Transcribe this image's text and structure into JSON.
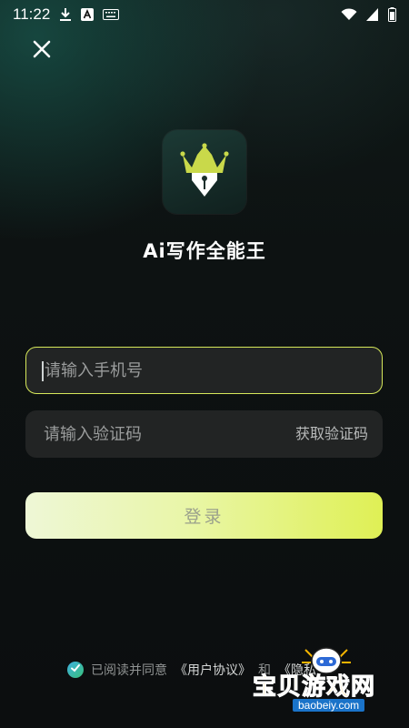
{
  "status_bar": {
    "time": "11:22",
    "left_icons": [
      "download-icon",
      "a-badge-icon",
      "keyboard-icon"
    ],
    "right_icons": [
      "wifi-icon",
      "signal-icon",
      "battery-icon"
    ]
  },
  "app": {
    "title": "Ai写作全能王",
    "logo_icon": "crown-pen-nib-icon"
  },
  "form": {
    "phone_placeholder": "请输入手机号",
    "phone_value": "",
    "code_placeholder": "请输入验证码",
    "code_value": "",
    "get_code_label": "获取验证码",
    "login_label": "登录"
  },
  "agreement": {
    "checked": true,
    "prefix": "已阅读并同意",
    "user_agreement": "《用户协议》",
    "conjunction": "和",
    "privacy_partial": "《隐私"
  },
  "watermark": {
    "text": "宝贝游戏网",
    "url": "baobeiy.com"
  },
  "colors": {
    "accent": "#d6e85a",
    "background": "#0d1212",
    "field_bg": "#222424"
  }
}
